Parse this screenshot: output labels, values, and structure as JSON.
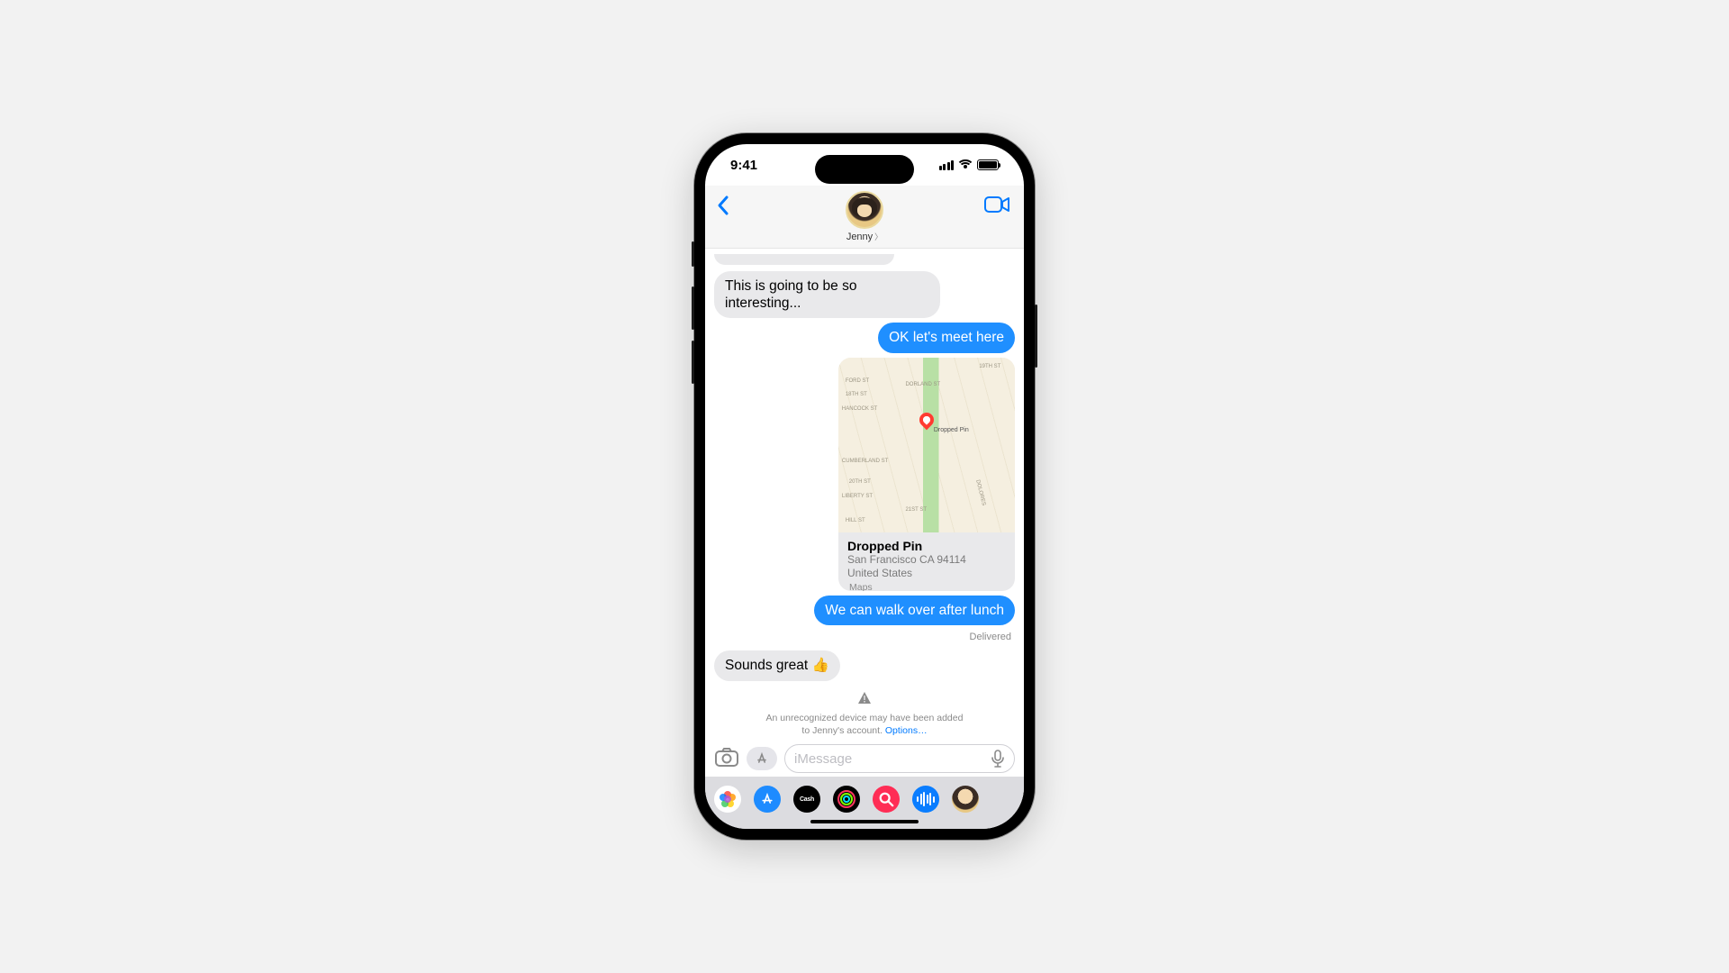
{
  "status": {
    "time": "9:41"
  },
  "header": {
    "contact_name": "Jenny"
  },
  "messages": {
    "m1": "This is going to be so interesting...",
    "m2": "OK let's meet here",
    "map": {
      "pin_label": "Dropped Pin",
      "title": "Dropped Pin",
      "addr1": "San Francisco CA 94114",
      "addr2": "United States",
      "source": "Maps",
      "streets": {
        "s1": "FORD ST",
        "s2": "18TH ST",
        "s3": "HANCOCK ST",
        "s4": "DORLAND ST",
        "s5": "19TH ST",
        "s6": "CUMBERLAND ST",
        "s7": "20TH ST",
        "s8": "LIBERTY ST",
        "s9": "21ST ST",
        "s10": "HILL ST",
        "s11": "DOLORES"
      }
    },
    "m3": "We can walk over after lunch",
    "delivered": "Delivered",
    "m4": "Sounds great 👍"
  },
  "alert": {
    "text_a": "An unrecognized device may have been added",
    "text_b": "to Jenny's account. ",
    "link": "Options…"
  },
  "compose": {
    "placeholder": "iMessage"
  },
  "apps": {
    "cash": "Cash",
    "store_aria": "App Store"
  }
}
